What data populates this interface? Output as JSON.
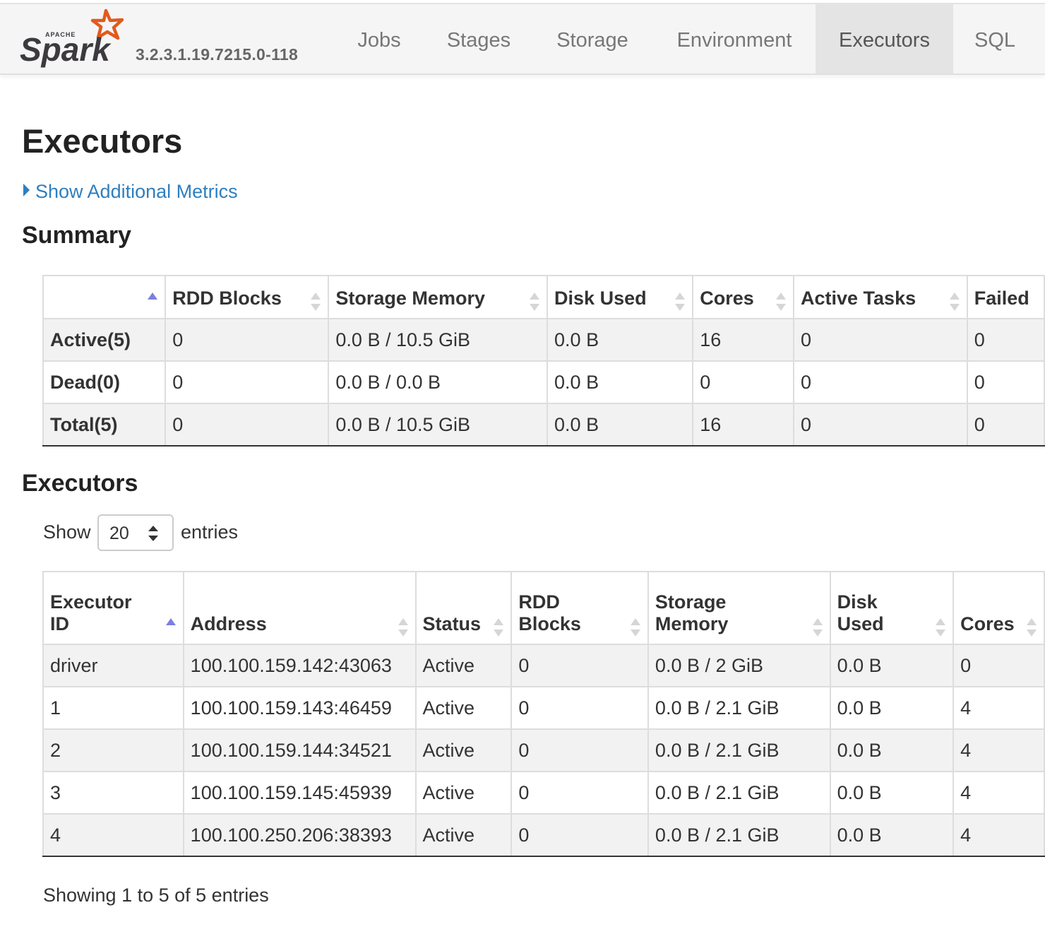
{
  "nav": {
    "logo_text": "Spark",
    "logo_apache": "APACHE",
    "version": "3.2.3.1.19.7215.0-118",
    "tabs": [
      "Jobs",
      "Stages",
      "Storage",
      "Environment",
      "Executors",
      "SQL"
    ],
    "active_tab": "Executors"
  },
  "page": {
    "title": "Executors",
    "metrics_link": "Show Additional Metrics"
  },
  "summary": {
    "heading": "Summary",
    "columns": [
      "",
      "RDD Blocks",
      "Storage Memory",
      "Disk Used",
      "Cores",
      "Active Tasks",
      "Failed"
    ],
    "rows": [
      [
        "Active(5)",
        "0",
        "0.0 B / 10.5 GiB",
        "0.0 B",
        "16",
        "0",
        "0"
      ],
      [
        "Dead(0)",
        "0",
        "0.0 B / 0.0 B",
        "0.0 B",
        "0",
        "0",
        "0"
      ],
      [
        "Total(5)",
        "0",
        "0.0 B / 10.5 GiB",
        "0.0 B",
        "16",
        "0",
        "0"
      ]
    ]
  },
  "executors": {
    "heading": "Executors",
    "show_label": "Show",
    "entries_label": "entries",
    "page_size": "20",
    "columns": [
      [
        "Executor",
        "ID"
      ],
      [
        "",
        "Address"
      ],
      [
        "",
        "Status"
      ],
      [
        "RDD",
        "Blocks"
      ],
      [
        "Storage",
        "Memory"
      ],
      [
        "Disk",
        "Used"
      ],
      [
        "",
        "Cores"
      ]
    ],
    "rows": [
      [
        "driver",
        "100.100.159.142:43063",
        "Active",
        "0",
        "0.0 B / 2 GiB",
        "0.0 B",
        "0"
      ],
      [
        "1",
        "100.100.159.143:46459",
        "Active",
        "0",
        "0.0 B / 2.1 GiB",
        "0.0 B",
        "4"
      ],
      [
        "2",
        "100.100.159.144:34521",
        "Active",
        "0",
        "0.0 B / 2.1 GiB",
        "0.0 B",
        "4"
      ],
      [
        "3",
        "100.100.159.145:45939",
        "Active",
        "0",
        "0.0 B / 2.1 GiB",
        "0.0 B",
        "4"
      ],
      [
        "4",
        "100.100.250.206:38393",
        "Active",
        "0",
        "0.0 B / 2.1 GiB",
        "0.0 B",
        "4"
      ]
    ],
    "info": "Showing 1 to 5 of 5 entries"
  },
  "colors": {
    "link": "#2f7fbf",
    "logo_orange": "#e25a1c",
    "logo_text": "#3c3a3e",
    "sort_active": "#7b7fe0"
  }
}
